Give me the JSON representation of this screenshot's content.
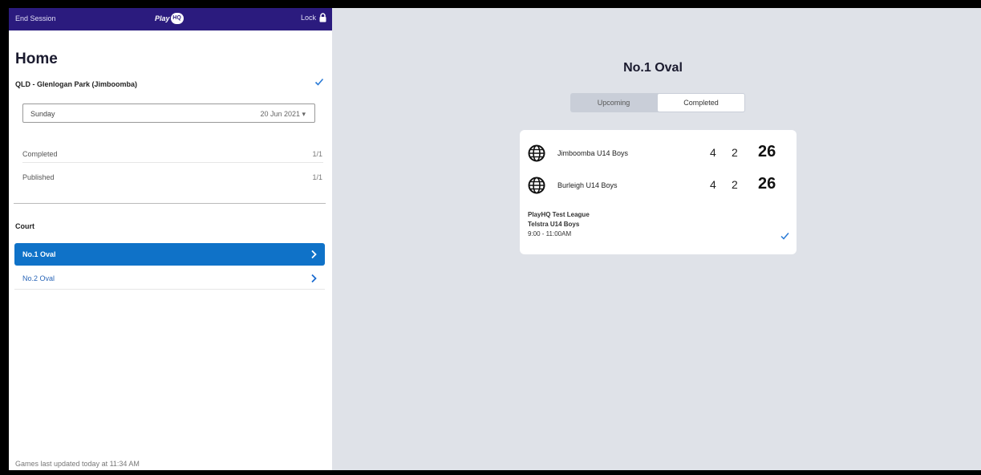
{
  "topbar": {
    "end_session": "End Session",
    "logo_text": "Play",
    "logo_badge": "HQ",
    "lock_label": "Lock"
  },
  "sidebar": {
    "title": "Home",
    "club": "QLD - Glenlogan Park (Jimboomba)",
    "date_select": {
      "day": "Sunday",
      "date": "20 Jun 2021 ▾"
    },
    "stats": [
      {
        "label": "Completed",
        "value": "1/1"
      },
      {
        "label": "Published",
        "value": "1/1"
      }
    ],
    "court_heading": "Court",
    "courts": [
      {
        "label": "No.1 Oval",
        "active": true
      },
      {
        "label": "No.2 Oval",
        "active": false
      }
    ],
    "footer": "Games last updated today at 11:34 AM"
  },
  "main": {
    "venue_title": "No.1 Oval",
    "tabs": [
      {
        "label": "Upcoming",
        "selected": false
      },
      {
        "label": "Completed",
        "selected": true
      }
    ],
    "game": {
      "teams": [
        {
          "name": "Jimboomba U14 Boys",
          "s1": "4",
          "s2": "2",
          "total": "26"
        },
        {
          "name": "Burleigh U14 Boys",
          "s1": "4",
          "s2": "2",
          "total": "26"
        }
      ],
      "league": "PlayHQ Test League",
      "grade": "Telstra U14 Boys",
      "time": "9:00 - 11:00AM"
    }
  },
  "colors": {
    "topbar": "#2b1b7e",
    "active_court": "#0f72c8",
    "link": "#2a66b8",
    "check": "#2a7ad6",
    "background": "#dfe2e8"
  },
  "icons": {
    "lock": "lock-icon",
    "check": "check-icon",
    "chevron": "chevron-right-icon",
    "team": "globe-icon"
  }
}
